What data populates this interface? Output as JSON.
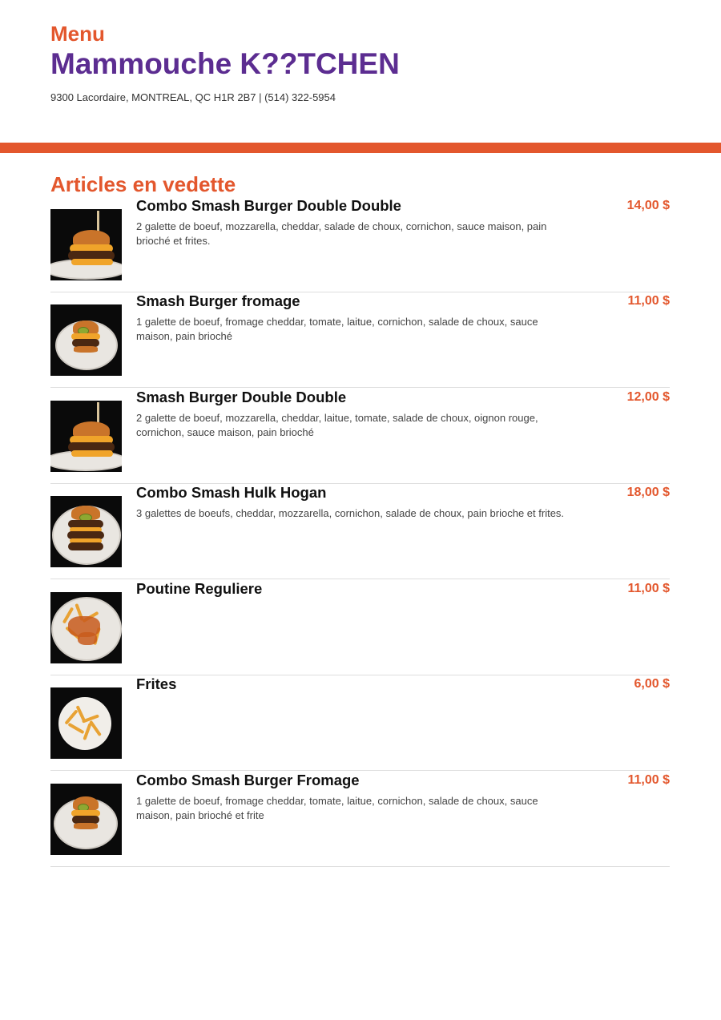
{
  "header": {
    "menu_label": "Menu",
    "restaurant_name": "Mammouche K??TCHEN",
    "address_line": "9300 Lacordaire, MONTREAL, QC H1R 2B7 | (514) 322-5954"
  },
  "section": {
    "title": "Articles en vedette"
  },
  "items": [
    {
      "name": "Combo Smash Burger Double Double",
      "description": "2 galette de boeuf, mozzarella, cheddar, salade de choux, cornichon, sauce maison, pain brioché et frites.",
      "price": "14,00 $",
      "photo": "burger-double-skewer-photo"
    },
    {
      "name": "Smash Burger fromage",
      "description": "1 galette de boeuf, fromage cheddar, tomate, laitue, cornichon, salade de choux, sauce maison, pain brioché",
      "price": "11,00 $",
      "photo": "burger-pickle-photo"
    },
    {
      "name": "Smash Burger Double Double",
      "description": "2 galette de boeuf, mozzarella, cheddar, laitue, tomate, salade de choux, oignon rouge, cornichon, sauce maison, pain brioché",
      "price": "12,00 $",
      "photo": "burger-double-skewer-photo"
    },
    {
      "name": "Combo Smash Hulk Hogan",
      "description": "3 galettes de boeufs, cheddar, mozzarella, cornichon, salade de choux, pain brioche et frites.",
      "price": "18,00 $",
      "photo": "burger-triple-photo"
    },
    {
      "name": "Poutine Reguliere",
      "description": "",
      "price": "11,00 $",
      "photo": "poutine-photo"
    },
    {
      "name": "Frites",
      "description": "",
      "price": "6,00 $",
      "photo": "fries-photo"
    },
    {
      "name": "Combo Smash Burger Fromage",
      "description": "1 galette de boeuf, fromage cheddar, tomate, laitue, cornichon, salade de choux, sauce maison, pain brioché et frite",
      "price": "11,00 $",
      "photo": "burger-pickle-photo"
    }
  ],
  "colors": {
    "accent": "#e3572d",
    "brand": "#5c2d91"
  }
}
